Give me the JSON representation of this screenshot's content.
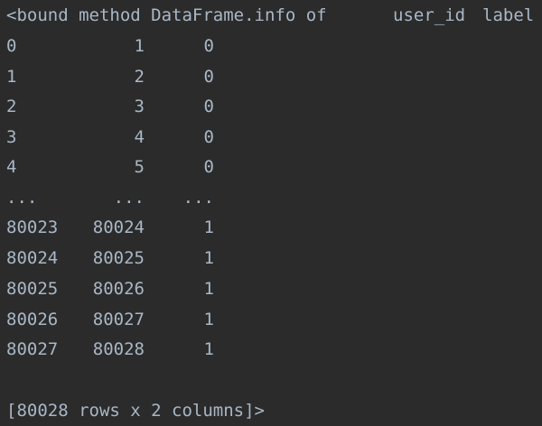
{
  "console": {
    "header": {
      "prefix": "<bound method DataFrame.info of",
      "columns": [
        "user_id",
        "label"
      ]
    },
    "rows": [
      {
        "index": "0",
        "user_id": "1",
        "label": "0"
      },
      {
        "index": "1",
        "user_id": "2",
        "label": "0"
      },
      {
        "index": "2",
        "user_id": "3",
        "label": "0"
      },
      {
        "index": "3",
        "user_id": "4",
        "label": "0"
      },
      {
        "index": "4",
        "user_id": "5",
        "label": "0"
      },
      {
        "index": "...",
        "user_id": "...",
        "label": "..."
      },
      {
        "index": "80023",
        "user_id": "80024",
        "label": "1"
      },
      {
        "index": "80024",
        "user_id": "80025",
        "label": "1"
      },
      {
        "index": "80025",
        "user_id": "80026",
        "label": "1"
      },
      {
        "index": "80026",
        "user_id": "80027",
        "label": "1"
      },
      {
        "index": "80027",
        "user_id": "80028",
        "label": "1"
      }
    ],
    "footer": "[80028 rows x 2 columns]>"
  },
  "colors": {
    "background": "#2b2b2b",
    "text": "#a9b7c6"
  }
}
